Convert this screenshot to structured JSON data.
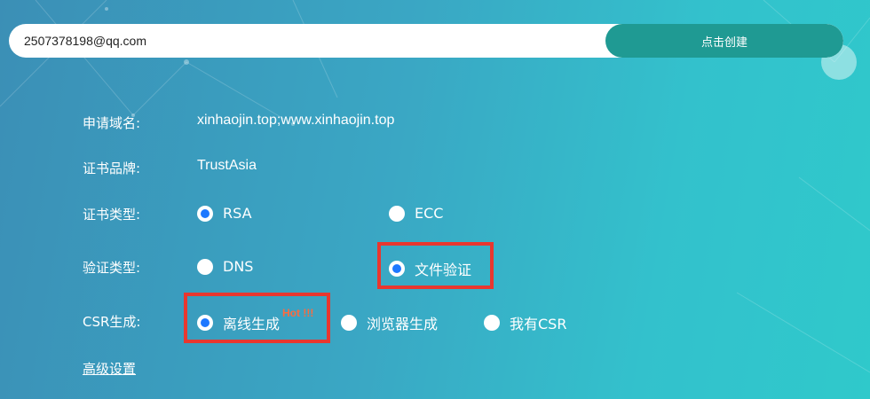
{
  "top_bar": {
    "email_value": "2507378198@qq.com",
    "create_button": "点击创建"
  },
  "domain": {
    "label": "申请域名:",
    "value": "xinhaojin.top;www.xinhaojin.top"
  },
  "brand": {
    "label": "证书品牌:",
    "value": "TrustAsia"
  },
  "cert_type": {
    "label": "证书类型:",
    "options": [
      {
        "label": "RSA",
        "checked": true
      },
      {
        "label": "ECC",
        "checked": false
      }
    ]
  },
  "verify_type": {
    "label": "验证类型:",
    "options": [
      {
        "label": "DNS",
        "checked": false
      },
      {
        "label": "文件验证",
        "checked": true
      }
    ]
  },
  "csr": {
    "label": "CSR生成:",
    "options": [
      {
        "label": "离线生成",
        "checked": true
      },
      {
        "label": "浏览器生成",
        "checked": false
      },
      {
        "label": "我有CSR",
        "checked": false
      }
    ],
    "hot_badge": "Hot !!!"
  },
  "advanced_link": "高级设置",
  "colors": {
    "button_teal": "#1f9a93",
    "radio_blue": "#1e78ff",
    "highlight_red": "#e8372f",
    "hot_orange": "#ff6a3d"
  }
}
